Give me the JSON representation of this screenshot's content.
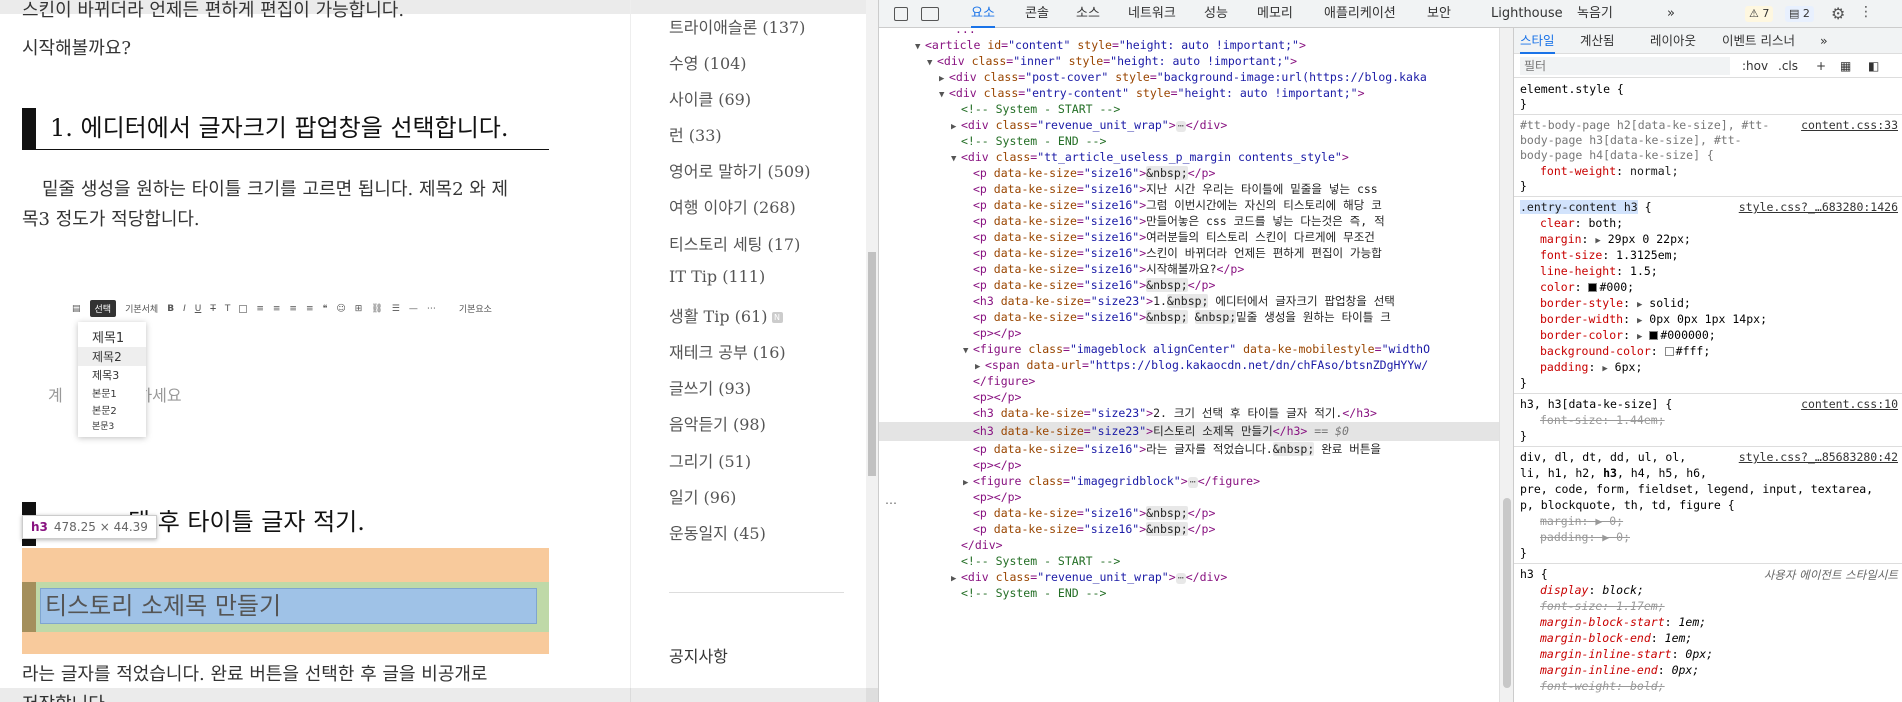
{
  "page": {
    "top_text": "스킨이 바뀌더라 언제든 편하게 편집이 가능합니다.",
    "p_start": "시작해볼까요?",
    "heading1": "1.  에디터에서 글자크기 팝업창을 선택합니다.",
    "para1_line1": "밑줄 생성을 원하는 타이틀 크기를 고르면 됩니다. 제목2 와 제",
    "para1_line2": "목3 정도가 적당합니다.",
    "editor": {
      "select_label": "선택",
      "style_label": "기본서체",
      "font_default": "기본요소",
      "placeholder": "제목을 입력하세요",
      "placeholder_short": "계",
      "dropdown": [
        "제목1",
        "제목2",
        "제목3",
        "본문1",
        "본문2",
        "본문3"
      ]
    },
    "tooltip": {
      "tag": "h3",
      "size": "478.25 × 44.39"
    },
    "heading2": "택 후 타이틀 글자 적기.",
    "highlight_heading": "티스토리 소제목 만들기",
    "bottom_text": "라는 글자를 적었습니다.  완료 버튼을 선택한 후 글을 비공개로",
    "bottom_text2": "저장합니다",
    "categories": [
      {
        "label": "트라이애슬론 (137)"
      },
      {
        "label": "수영 (104)"
      },
      {
        "label": "사이클 (69)"
      },
      {
        "label": "런 (33)"
      },
      {
        "label": "영어로 말하기 (509)"
      },
      {
        "label": "여행 이야기 (268)"
      },
      {
        "label": "티스토리 세팅 (17)"
      },
      {
        "label": "IT Tip (111)"
      },
      {
        "label": "생활 Tip (61)",
        "badge": "N"
      },
      {
        "label": "재테크 공부 (16)"
      },
      {
        "label": "글쓰기 (93)"
      },
      {
        "label": "음악듣기 (98)"
      },
      {
        "label": "그리기 (51)"
      },
      {
        "label": "일기 (96)"
      },
      {
        "label": "운동일지 (45)"
      }
    ],
    "notice": "공지사항"
  },
  "devtools": {
    "tabs": [
      "요소",
      "콘솔",
      "소스",
      "네트워크",
      "성능",
      "메모리",
      "애플리케이션",
      "보안",
      "Lighthouse",
      "녹음기",
      "»"
    ],
    "warn_count": "7",
    "msg_count": "2",
    "styles_tabs": [
      "스타일",
      "계산됨",
      "레이아웃",
      "이벤트 리스너",
      "»"
    ],
    "filter_placeholder": "필터",
    "hov": ":hov",
    "cls": ".cls"
  },
  "colors": {
    "accent": "#1a73e8",
    "tag": "#881280",
    "attr": "#994500",
    "value": "#1a1aa6",
    "comment": "#236e25",
    "highlight_orange": "#f8ca9c",
    "highlight_green": "#bfd9a8",
    "highlight_blue": "#9fc2e7"
  }
}
